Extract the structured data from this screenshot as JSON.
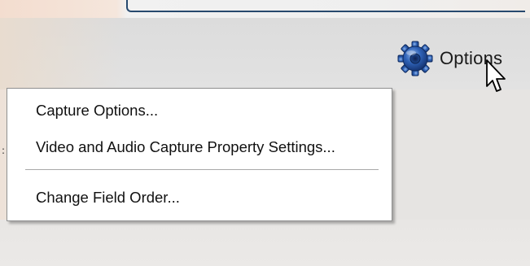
{
  "toolbar": {
    "options_label": "Options",
    "options_icon": "gear-icon"
  },
  "menu": {
    "items": [
      {
        "label": "Capture Options..."
      },
      {
        "label": "Video and Audio Capture Property Settings..."
      },
      {
        "label": "Change Field Order..."
      }
    ]
  },
  "colors": {
    "accent_rule": "#27496e",
    "menu_background": "#ffffff",
    "window_background": "#e6e4e2"
  }
}
